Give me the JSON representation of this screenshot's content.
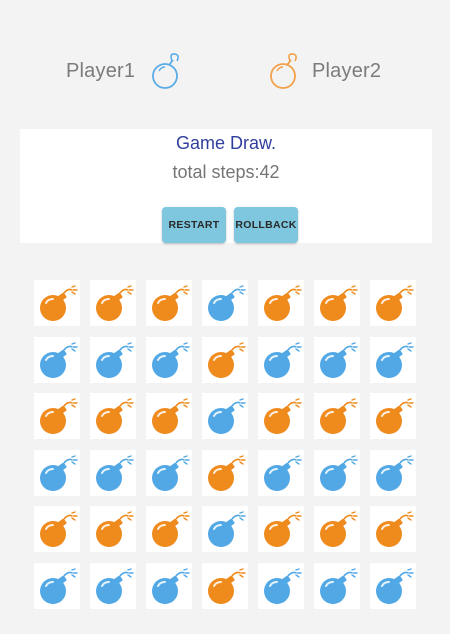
{
  "players": {
    "player1": {
      "name": "Player1",
      "icon": "bomb-outline-icon",
      "color": "#5aace6"
    },
    "player2": {
      "name": "Player2",
      "icon": "bomb-outline-icon",
      "color": "#f2a049"
    }
  },
  "status": {
    "message": "Game Draw.",
    "steps_label": "total steps:",
    "steps_value": "42"
  },
  "buttons": {
    "restart": "RESTART",
    "rollback": "ROLLBACK"
  },
  "colors": {
    "orange": "#ef8a1c",
    "blue": "#52a8e5",
    "button": "#7ec7df",
    "status_text": "#303f9f"
  },
  "board": {
    "rows": 6,
    "cols": 7,
    "cells": [
      [
        "orange",
        "orange",
        "orange",
        "blue",
        "orange",
        "orange",
        "orange"
      ],
      [
        "blue",
        "blue",
        "blue",
        "orange",
        "blue",
        "blue",
        "blue"
      ],
      [
        "orange",
        "orange",
        "orange",
        "blue",
        "orange",
        "orange",
        "orange"
      ],
      [
        "blue",
        "blue",
        "blue",
        "orange",
        "blue",
        "blue",
        "blue"
      ],
      [
        "orange",
        "orange",
        "orange",
        "blue",
        "orange",
        "orange",
        "orange"
      ],
      [
        "blue",
        "blue",
        "blue",
        "orange",
        "blue",
        "blue",
        "blue"
      ]
    ]
  }
}
